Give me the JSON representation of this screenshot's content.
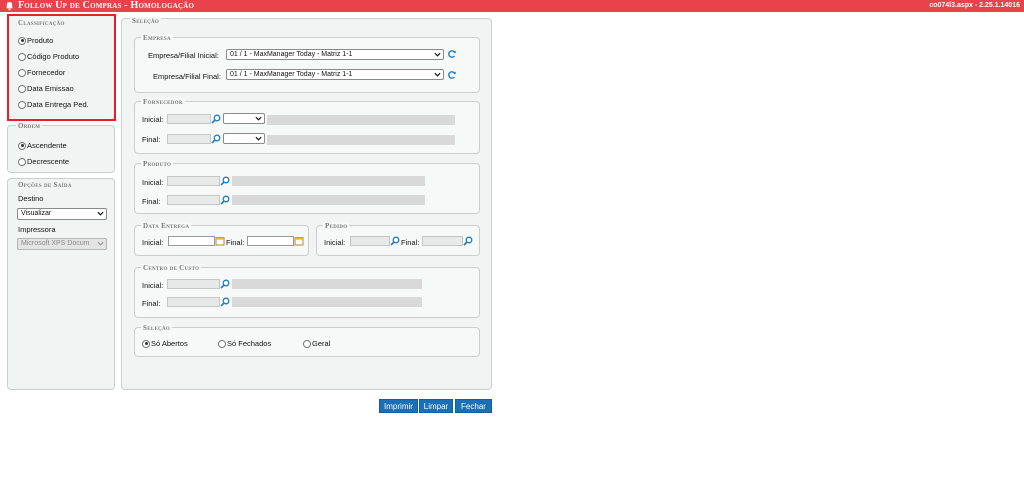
{
  "header": {
    "title": "Follow Up de Compras  - Homologação",
    "version": "co074l3.aspx - 2.25.1.14016"
  },
  "classificacao": {
    "legend": "Classificação",
    "options": [
      {
        "label": "Produto",
        "checked": true
      },
      {
        "label": "Código Produto",
        "checked": false
      },
      {
        "label": "Fornecedor",
        "checked": false
      },
      {
        "label": "Data Emissao",
        "checked": false
      },
      {
        "label": "Data Entrega Ped.",
        "checked": false
      }
    ]
  },
  "ordem": {
    "legend": "Ordem",
    "options": [
      {
        "label": "Ascendente",
        "checked": true
      },
      {
        "label": "Decrescente",
        "checked": false
      }
    ]
  },
  "saida": {
    "legend": "Opções de Saída",
    "destino_label": "Destino",
    "destino_value": "Visualizar",
    "impressora_label": "Impressora",
    "impressora_value": "Microsoft XPS Docum"
  },
  "selecao": {
    "legend": "Seleção",
    "empresa": {
      "legend": "Empresa",
      "inicial_label": "Empresa/Filial Inicial:",
      "inicial_value": "01 / 1 - MaxManager Today - Matriz 1-1",
      "final_label": "Empresa/Filial Final:",
      "final_value": "01 / 1 - MaxManager Today - Matriz 1-1"
    },
    "fornecedor": {
      "legend": "Fornecedor",
      "inicial_label": "Inicial:",
      "final_label": "Final:"
    },
    "produto": {
      "legend": "Produto",
      "inicial_label": "Inicial:",
      "final_label": "Final:"
    },
    "data_entrega": {
      "legend": "Data Entrega",
      "inicial_label": "Inicial:",
      "final_label": "Final:"
    },
    "pedido": {
      "legend": "Pedido",
      "inicial_label": "Inicial:",
      "final_label": "Final:"
    },
    "centro_custo": {
      "legend": "Centro de Custo",
      "inicial_label": "Inicial:",
      "final_label": "Final:"
    },
    "situacao": {
      "legend": "Seleção",
      "options": [
        {
          "label": "Só Abertos",
          "checked": true
        },
        {
          "label": "Só Fechados",
          "checked": false
        },
        {
          "label": "Geral",
          "checked": false
        }
      ]
    }
  },
  "buttons": {
    "imprimir": "Imprimir",
    "limpar": "Limpar",
    "fechar": "Fechar"
  },
  "colors": {
    "header": "#e8424a",
    "button": "#1a6fb7",
    "highlight": "#e5202b"
  }
}
